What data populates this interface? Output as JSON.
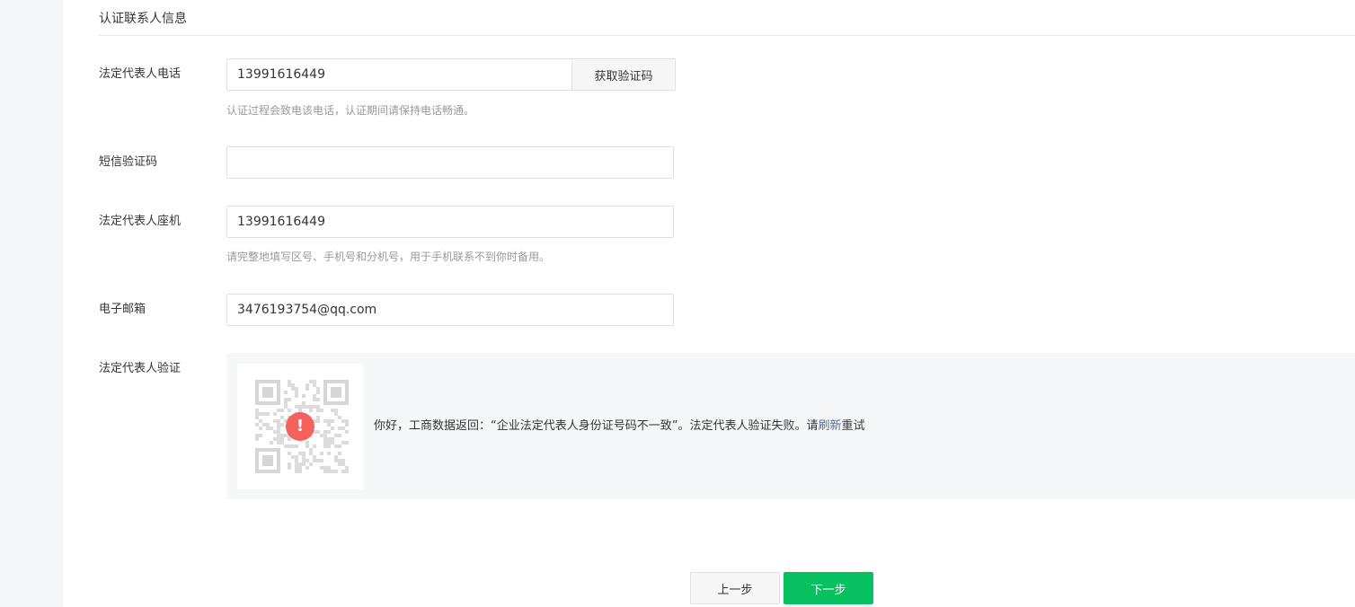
{
  "section": {
    "title": "认证联系人信息"
  },
  "form": {
    "phone": {
      "label": "法定代表人电话",
      "value": "13991616449",
      "button": "获取验证码",
      "hint": "认证过程会致电该电话，认证期间请保持电话畅通。"
    },
    "sms_code": {
      "label": "短信验证码",
      "value": ""
    },
    "landline": {
      "label": "法定代表人座机",
      "value": "13991616449",
      "hint": "请完整地填写区号、手机号和分机号，用于手机联系不到你时备用。"
    },
    "email": {
      "label": "电子邮箱",
      "value": "3476193754@qq.com"
    },
    "verification": {
      "label": "法定代表人验证",
      "error_icon": "!",
      "message_prefix": "你好，工商数据返回：“企业法定代表人身份证号码不一致”。法定代表人验证失败。请",
      "refresh_link": "刷新",
      "message_suffix": "重试"
    }
  },
  "footer": {
    "prev_label": "上一步",
    "next_label": "下一步"
  },
  "colors": {
    "primary": "#07c160",
    "link": "#576b95",
    "error": "#f5615d",
    "hint": "#9a9a9a"
  }
}
